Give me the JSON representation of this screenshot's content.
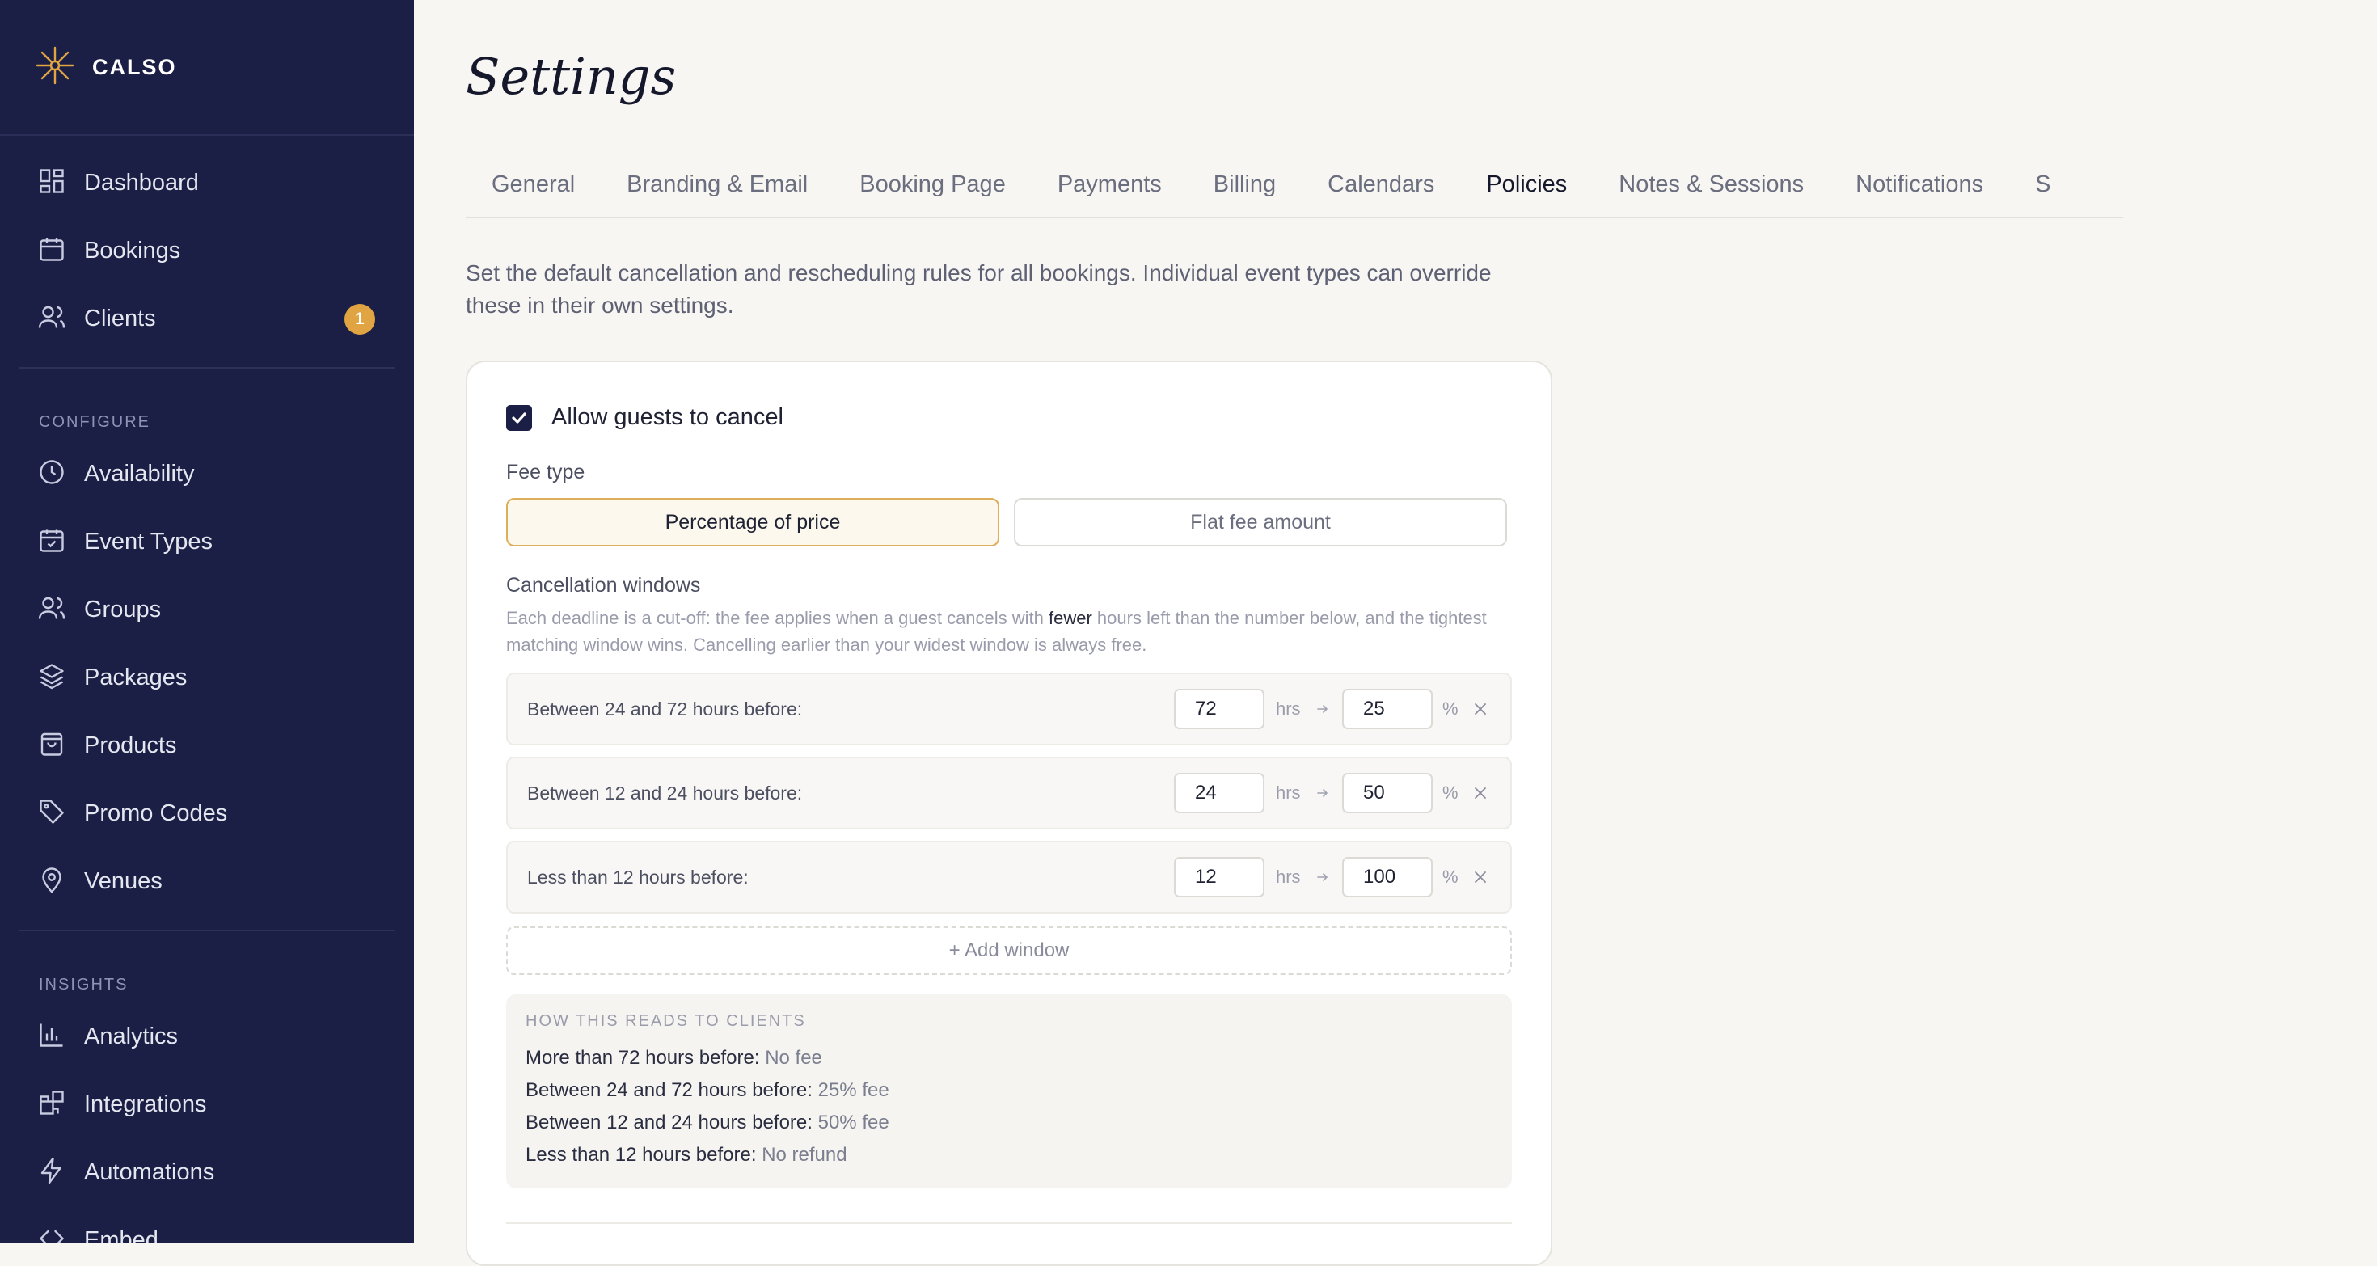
{
  "app": {
    "name": "CALSO"
  },
  "sidebar": {
    "main_items": [
      {
        "label": "Dashboard",
        "icon": "grid-icon"
      },
      {
        "label": "Bookings",
        "icon": "calendar-icon"
      },
      {
        "label": "Clients",
        "icon": "users-icon",
        "badge": "1"
      }
    ],
    "configure_label": "CONFIGURE",
    "configure_items": [
      {
        "label": "Availability",
        "icon": "clock-icon"
      },
      {
        "label": "Event Types",
        "icon": "calendar-check-icon"
      },
      {
        "label": "Groups",
        "icon": "users-icon"
      },
      {
        "label": "Packages",
        "icon": "layers-icon"
      },
      {
        "label": "Products",
        "icon": "shopping-bag-icon"
      },
      {
        "label": "Promo Codes",
        "icon": "tag-icon"
      },
      {
        "label": "Venues",
        "icon": "map-pin-icon"
      }
    ],
    "insights_label": "INSIGHTS",
    "insights_items": [
      {
        "label": "Analytics",
        "icon": "bar-chart-icon"
      },
      {
        "label": "Integrations",
        "icon": "puzzle-icon"
      },
      {
        "label": "Automations",
        "icon": "lightning-icon"
      },
      {
        "label": "Embed",
        "icon": "code-icon"
      }
    ]
  },
  "page": {
    "title": "Settings",
    "tabs": [
      "General",
      "Branding & Email",
      "Booking Page",
      "Payments",
      "Billing",
      "Calendars",
      "Policies",
      "Notes & Sessions",
      "Notifications",
      "S"
    ],
    "active_tab": "Policies",
    "intro": "Set the default cancellation and rescheduling rules for all bookings. Individual event types can override these in their own settings."
  },
  "policy": {
    "allow_cancel_label": "Allow guests to cancel",
    "allow_cancel_checked": true,
    "fee_type_label": "Fee type",
    "fee_options": [
      "Percentage of price",
      "Flat fee amount"
    ],
    "fee_selected": "Percentage of price",
    "windows_label": "Cancellation windows",
    "help_before": "Each deadline is a cut-off: the fee applies when a guest cancels with ",
    "help_em": "fewer",
    "help_after": " hours left than the number below, and the tightest matching window wins. Cancelling earlier than your widest window is always free.",
    "hours_unit": "hrs",
    "percent_unit": "%",
    "windows": [
      {
        "label": "Between 24 and 72 hours before:",
        "hours": "72",
        "fee": "25"
      },
      {
        "label": "Between 12 and 24 hours before:",
        "hours": "24",
        "fee": "50"
      },
      {
        "label": "Less than 12 hours before:",
        "hours": "12",
        "fee": "100"
      }
    ],
    "add_window_label": "+ Add window",
    "preview_title": "HOW THIS READS TO CLIENTS",
    "preview_lines": [
      {
        "label": "More than 72 hours before:",
        "value": "No fee"
      },
      {
        "label": "Between 24 and 72 hours before:",
        "value": "25% fee"
      },
      {
        "label": "Between 12 and 24 hours before:",
        "value": "50% fee"
      },
      {
        "label": "Less than 12 hours before:",
        "value": "No refund"
      }
    ]
  },
  "colors": {
    "sidebar_bg": "#1c1f45",
    "accent": "#d9943c",
    "badge": "#e0a443"
  }
}
